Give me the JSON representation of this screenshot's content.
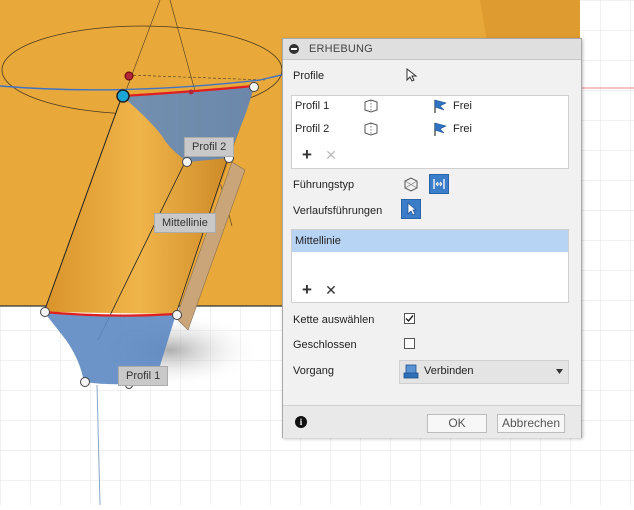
{
  "viewport": {
    "labels": {
      "profil2": "Profil 2",
      "mittellinie": "Mittellinie",
      "profil1": "Profil 1"
    }
  },
  "panel": {
    "title": "ERHEBUNG",
    "profile": {
      "label": "Profile",
      "items": [
        {
          "name": "Profil 1",
          "continuity": "Frei"
        },
        {
          "name": "Profil 2",
          "continuity": "Frei"
        }
      ]
    },
    "fuehrungstyp": {
      "label": "Führungstyp"
    },
    "verlauf": {
      "label": "Verlaufsführungen",
      "items": [
        "Mittellinie"
      ]
    },
    "kette": {
      "label": "Kette auswählen",
      "checked": true
    },
    "geschlossen": {
      "label": "Geschlossen",
      "checked": false
    },
    "vorgang": {
      "label": "Vorgang",
      "value": "Verbinden"
    },
    "footer": {
      "ok": "OK",
      "cancel": "Abbrechen"
    }
  },
  "colors": {
    "body_orange": "#e8a83a",
    "profile_blue": "#5c88c2",
    "selection_blue": "#b8d4f4",
    "accent_blue": "#3c7dc9"
  }
}
